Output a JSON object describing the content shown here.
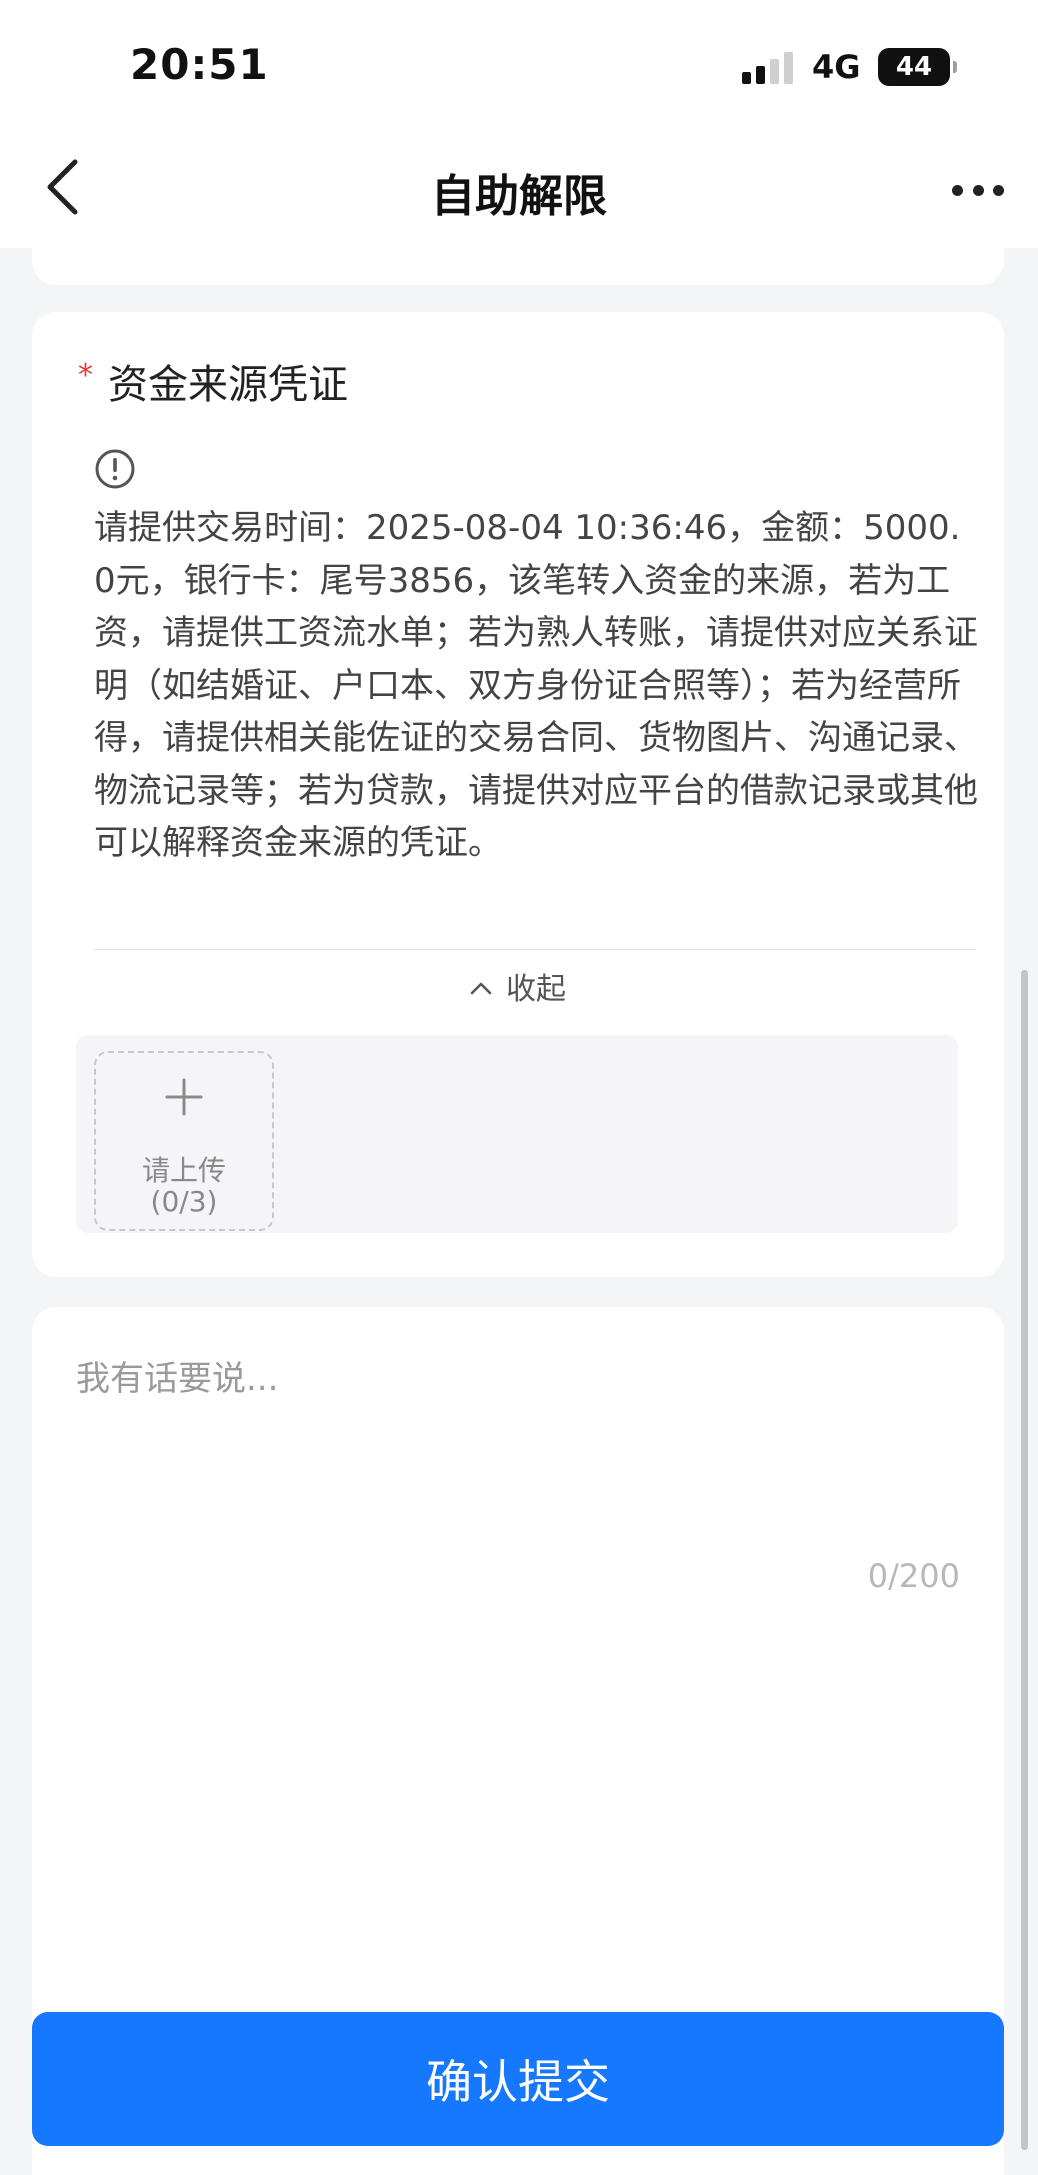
{
  "status_bar": {
    "time": "20:51",
    "network": "4G",
    "battery": "44"
  },
  "nav": {
    "title": "自助解限"
  },
  "section": {
    "title": "资金来源凭证",
    "required_mark": "*",
    "description": "请提供交易时间：2025-08-04 10:36:46，金额：5000.0元，银行卡：尾号3856，该笔转入资金的来源，若为工资，请提供工资流水单；若为熟人转账，请提供对应关系证明（如结婚证、户口本、双方身份证合照等）；若为经营所得，请提供相关能佐证的交易合同、货物图片、沟通记录、物流记录等；若为贷款，请提供对应平台的借款记录或其他可以解释资金来源的凭证。",
    "collapse_label": "收起",
    "upload": {
      "label": "请上传",
      "count": "(0/3)"
    }
  },
  "comment": {
    "placeholder": "我有话要说...",
    "counter": "0/200"
  },
  "submit": {
    "label": "确认提交"
  },
  "colors": {
    "primary": "#1677ff",
    "required": "#e53935",
    "background": "#f4f5f7"
  },
  "icons": {
    "back": "chevron-left-icon",
    "more": "more-horizontal-icon",
    "info": "exclamation-circle-icon",
    "collapse": "chevron-up-icon",
    "upload": "plus-icon"
  }
}
